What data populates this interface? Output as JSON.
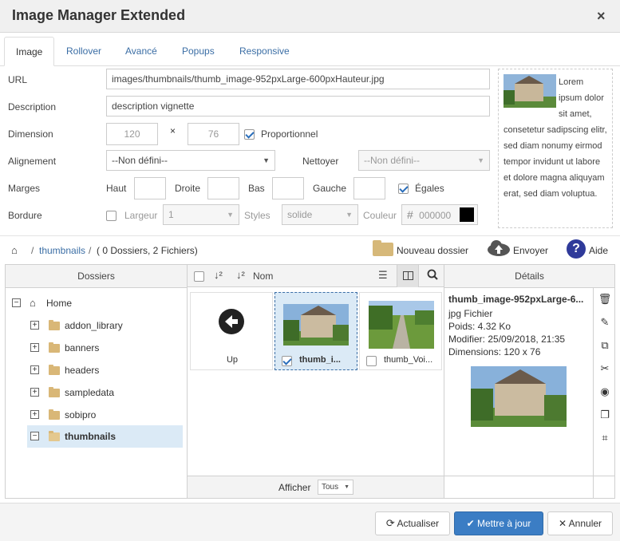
{
  "window": {
    "title": "Image Manager Extended",
    "close": "×"
  },
  "tabs": [
    "Image",
    "Rollover",
    "Avancé",
    "Popups",
    "Responsive"
  ],
  "form": {
    "url_label": "URL",
    "url_value": "images/thumbnails/thumb_image-952pxLarge-600pxHauteur.jpg",
    "description_label": "Description",
    "description_value": "description vignette",
    "dimension_label": "Dimension",
    "width": "120",
    "times": "×",
    "height": "76",
    "proportional_label": "Proportionnel",
    "proportional_checked": true,
    "alignment_label": "Alignement",
    "alignment_value": "--Non défini--",
    "clear_label": "Nettoyer",
    "clear_value": "--Non défini--",
    "margins_label": "Marges",
    "margin_top_label": "Haut",
    "margin_right_label": "Droite",
    "margin_bottom_label": "Bas",
    "margin_left_label": "Gauche",
    "equal_label": "Égales",
    "equal_checked": true,
    "border_label": "Bordure",
    "border_width_label": "Largeur",
    "border_width_value": "1",
    "border_style_label": "Styles",
    "border_style_value": "solide",
    "border_color_label": "Couleur",
    "border_color_hash": "#",
    "border_color_value": "000000",
    "border_color_swatch": "#000000"
  },
  "preview": {
    "text": "Lorem ipsum dolor sit amet, consetetur sadipscing elitr, sed diam nonumy eirmod tempor invidunt ut labore et dolore magna aliquyam erat, sed diam voluptua."
  },
  "browser": {
    "breadcrumb_sep": "/",
    "breadcrumb_folder": "thumbnails",
    "breadcrumb_info": "( 0 Dossiers, 2 Fichiers)",
    "new_folder": "Nouveau dossier",
    "upload": "Envoyer",
    "help": "Aide",
    "folders_header": "Dossiers",
    "name_header": "Nom",
    "details_header": "Détails",
    "tree": [
      {
        "label": "Home",
        "root": true
      },
      {
        "label": "addon_library"
      },
      {
        "label": "banners"
      },
      {
        "label": "headers"
      },
      {
        "label": "sampledata"
      },
      {
        "label": "sobipro"
      },
      {
        "label": "thumbnails",
        "active": true
      }
    ],
    "files": [
      {
        "label": "Up"
      },
      {
        "label": "thumb_i...",
        "checked": true
      },
      {
        "label": "thumb_Voi...",
        "checked": false
      }
    ],
    "show_label": "Afficher",
    "show_value": "Tous",
    "details": {
      "name": "thumb_image-952pxLarge-6...",
      "type": "jpg Fichier",
      "size": "Poids: 4.32 Ko",
      "modified": "Modifier: 25/09/2018, 21:35",
      "dimensions": "Dimensions: 120 x 76"
    }
  },
  "footer": {
    "refresh": "Actualiser",
    "update": "Mettre à jour",
    "cancel": "Annuler"
  },
  "colors": {
    "accent": "#3b7dc4",
    "link": "#3b6ea5",
    "selection": "#dbeaf6"
  }
}
